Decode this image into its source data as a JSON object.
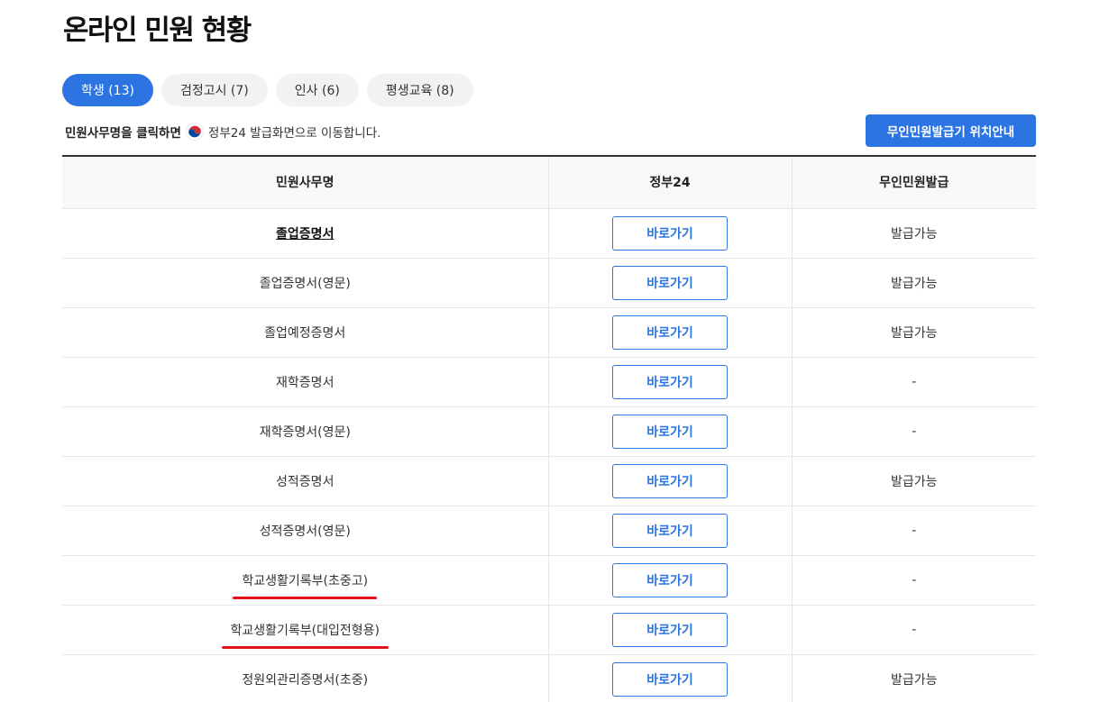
{
  "page": {
    "title": "온라인 민원 현황"
  },
  "tabs": [
    {
      "label": "학생 (13)",
      "active": true
    },
    {
      "label": "검정고시 (7)",
      "active": false
    },
    {
      "label": "인사 (6)",
      "active": false
    },
    {
      "label": "평생교육 (8)",
      "active": false
    }
  ],
  "notice": {
    "strong": "민원사무명을 클릭하면",
    "icon": "government-emblem-icon",
    "text": "정부24 발급화면으로 이동합니다."
  },
  "kiosk_button": {
    "label": "무인민원발급기 위치안내"
  },
  "table": {
    "headers": [
      "민원사무명",
      "정부24",
      "무인민원발급"
    ],
    "rows": [
      {
        "name": "졸업증명서",
        "action": "바로가기",
        "kiosk": "발급가능"
      },
      {
        "name": "졸업증명서(영문)",
        "action": "바로가기",
        "kiosk": "발급가능"
      },
      {
        "name": "졸업예정증명서",
        "action": "바로가기",
        "kiosk": "발급가능"
      },
      {
        "name": "재학증명서",
        "action": "바로가기",
        "kiosk": "-"
      },
      {
        "name": "재학증명서(영문)",
        "action": "바로가기",
        "kiosk": "-"
      },
      {
        "name": "성적증명서",
        "action": "바로가기",
        "kiosk": "발급가능"
      },
      {
        "name": "성적증명서(영문)",
        "action": "바로가기",
        "kiosk": "-"
      },
      {
        "name": "학교생활기록부(초중고)",
        "action": "바로가기",
        "kiosk": "-"
      },
      {
        "name": "학교생활기록부(대입전형용)",
        "action": "바로가기",
        "kiosk": "-"
      },
      {
        "name": "정원외관리증명서(초중)",
        "action": "바로가기",
        "kiosk": "발급가능"
      }
    ]
  },
  "colors": {
    "primary": "#2b74e2",
    "annotation_red": "#e2121b"
  }
}
